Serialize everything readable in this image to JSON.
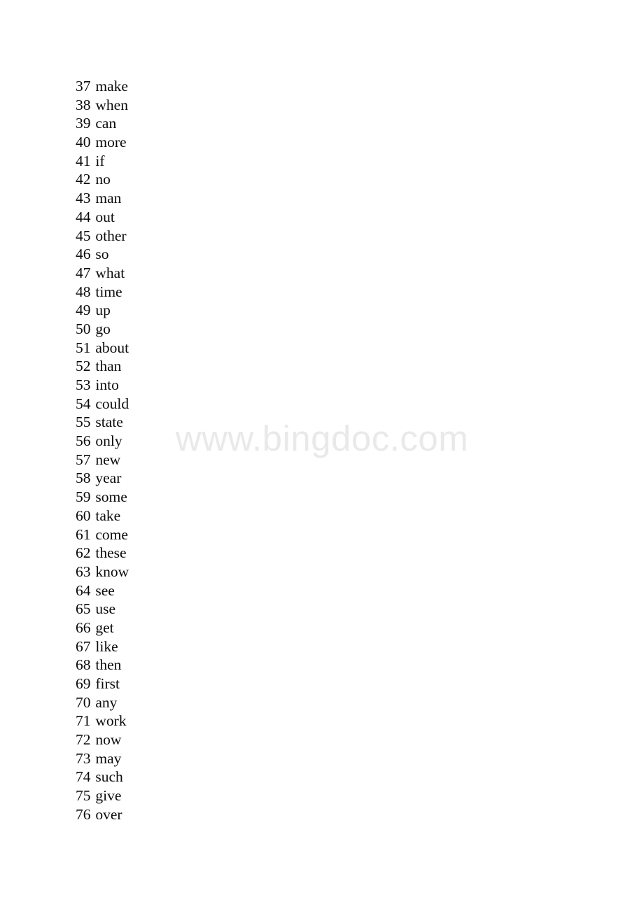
{
  "document": {
    "type": "word-frequency-list",
    "background_color": "#ffffff",
    "text_color": "#0b0b0b",
    "watermark": {
      "text": "www.bingdoc.com",
      "color": "#e9e9e9"
    },
    "entries": [
      {
        "number": "37",
        "word": "make"
      },
      {
        "number": "38",
        "word": "when"
      },
      {
        "number": "39",
        "word": "can"
      },
      {
        "number": "40",
        "word": "more"
      },
      {
        "number": "41",
        "word": "if"
      },
      {
        "number": "42",
        "word": "no"
      },
      {
        "number": "43",
        "word": "man"
      },
      {
        "number": "44",
        "word": "out"
      },
      {
        "number": "45",
        "word": "other"
      },
      {
        "number": "46",
        "word": "so"
      },
      {
        "number": "47",
        "word": "what"
      },
      {
        "number": "48",
        "word": "time"
      },
      {
        "number": "49",
        "word": "up"
      },
      {
        "number": "50",
        "word": "go"
      },
      {
        "number": "51",
        "word": "about"
      },
      {
        "number": "52",
        "word": "than"
      },
      {
        "number": "53",
        "word": "into"
      },
      {
        "number": "54",
        "word": "could"
      },
      {
        "number": "55",
        "word": "state"
      },
      {
        "number": "56",
        "word": "only"
      },
      {
        "number": "57",
        "word": "new"
      },
      {
        "number": "58",
        "word": "year"
      },
      {
        "number": "59",
        "word": "some"
      },
      {
        "number": "60",
        "word": "take"
      },
      {
        "number": "61",
        "word": "come"
      },
      {
        "number": "62",
        "word": "these"
      },
      {
        "number": "63",
        "word": "know"
      },
      {
        "number": "64",
        "word": "see"
      },
      {
        "number": "65",
        "word": "use"
      },
      {
        "number": "66",
        "word": "get"
      },
      {
        "number": "67",
        "word": "like"
      },
      {
        "number": "68",
        "word": "then"
      },
      {
        "number": "69",
        "word": "first"
      },
      {
        "number": "70",
        "word": "any"
      },
      {
        "number": "71",
        "word": "work"
      },
      {
        "number": "72",
        "word": "now"
      },
      {
        "number": "73",
        "word": "may"
      },
      {
        "number": "74",
        "word": "such"
      },
      {
        "number": "75",
        "word": "give"
      },
      {
        "number": "76",
        "word": "over"
      }
    ]
  }
}
